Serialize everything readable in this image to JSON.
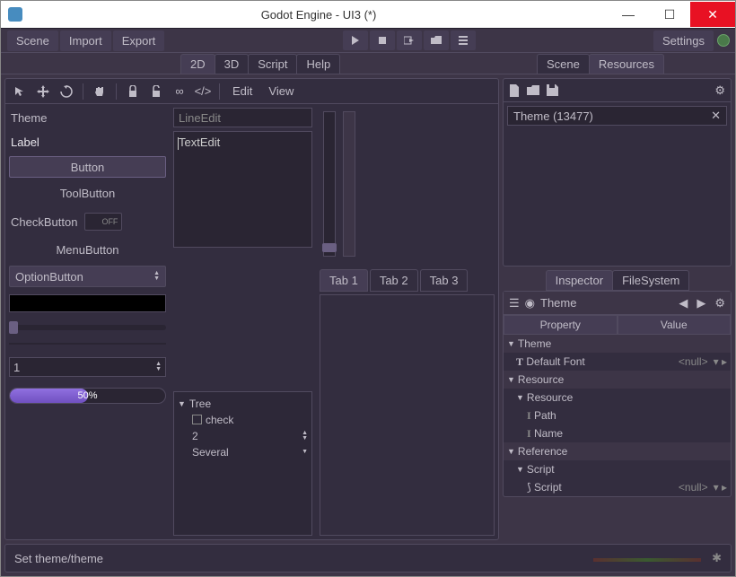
{
  "window": {
    "title": "Godot Engine - UI3 (*)"
  },
  "menubar": {
    "scene": "Scene",
    "import": "Import",
    "export": "Export"
  },
  "topbar": {
    "settings": "Settings"
  },
  "viewtabs": {
    "v2d": "2D",
    "v3d": "3D",
    "script": "Script",
    "help": "Help"
  },
  "scene_tabs": {
    "scene": "Scene",
    "resources": "Resources"
  },
  "editor_menu": {
    "edit": "Edit",
    "view": "View"
  },
  "demo": {
    "theme": "Theme",
    "label": "Label",
    "button": "Button",
    "toolbutton": "ToolButton",
    "checkbutton": "CheckButton",
    "toggle_off": "OFF",
    "menubutton": "MenuButton",
    "optionbutton": "OptionButton",
    "spin_value": "1",
    "progress_text": "50%",
    "lineedit_ph": "LineEdit",
    "textedit_text": "TextEdit",
    "tree_root": "Tree",
    "tree_check": "check",
    "tree_two": "2",
    "tree_several": "Several",
    "tab1": "Tab 1",
    "tab2": "Tab 2",
    "tab3": "Tab 3"
  },
  "resources": {
    "filter": "Theme (13477)"
  },
  "inspector": {
    "tab_inspector": "Inspector",
    "tab_filesystem": "FileSystem",
    "object": "Theme",
    "col_property": "Property",
    "col_value": "Value",
    "sec_theme": "Theme",
    "default_font": "Default Font",
    "null": "<null>",
    "sec_resource": "Resource",
    "sub_resource": "Resource",
    "path": "Path",
    "name": "Name",
    "sec_reference": "Reference",
    "sub_script": "Script",
    "script": "Script"
  },
  "status": {
    "text": "Set theme/theme"
  }
}
